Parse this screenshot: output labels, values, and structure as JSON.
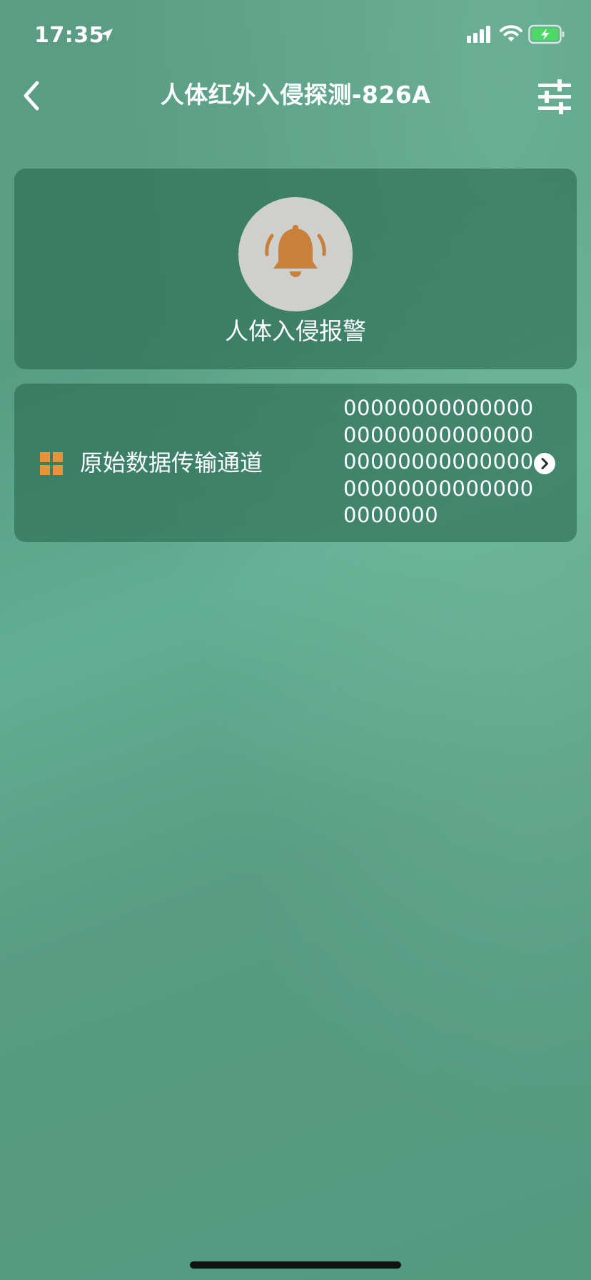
{
  "status_bar": {
    "time": "17:35",
    "icons": [
      "location-arrow-icon",
      "signal-bars-icon",
      "wifi-icon",
      "battery-charging-icon"
    ]
  },
  "nav": {
    "title": "人体红外入侵探测-826A",
    "back_icon": "chevron-left-icon",
    "settings_icon": "sliders-icon"
  },
  "alarm_card": {
    "label": "人体入侵报警",
    "icon": "bell-ringing-icon",
    "icon_color": "#c8803a"
  },
  "data_card": {
    "label": "原始数据传输通道",
    "value": "000000000000000000000000000000000000000000000000000000000000000",
    "icon": "grid-icon",
    "icon_color": "#e8923a",
    "chevron_icon": "chevron-right-circle-icon"
  },
  "colors": {
    "background": "#579d84",
    "card": "#3a7d63",
    "text": "#ffffff"
  }
}
